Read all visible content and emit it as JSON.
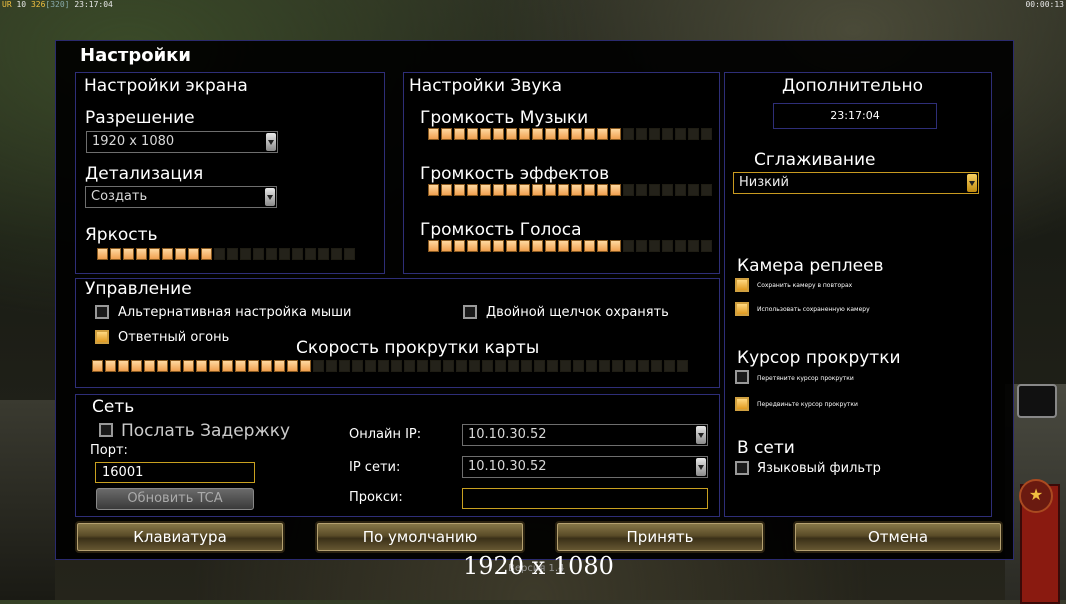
{
  "hud": {
    "left_prefix": "UR",
    "left_a": "10",
    "left_b": "326",
    "left_c": "[320]",
    "left_time": "23:17:04",
    "right_time": "00:00:13"
  },
  "title": "Настройки",
  "screen": {
    "header": "Настройки экрана",
    "resolution_label": "Разрешение",
    "resolution_value": "1920 x 1080",
    "detail_label": "Детализация",
    "detail_value": "Создать",
    "brightness_label": "Яркость",
    "brightness_level": 0.45
  },
  "sound": {
    "header": "Настройки Звука",
    "music_label": "Громкость Музыки",
    "music_level": 0.68,
    "effects_label": "Громкость эффектов",
    "effects_level": 0.68,
    "voice_label": "Громкость Голоса",
    "voice_level": 0.68
  },
  "extra": {
    "header": "Дополнительно",
    "clock": "23:17:04",
    "antialias_label": "Сглаживание",
    "antialias_value": "Низкий",
    "replay_header": "Камера реплеев",
    "replay_opt1": "Сохранить камеру в повторах",
    "replay_opt2": "Использовать сохраненную камеру",
    "scroll_header": "Курсор прокрутки",
    "scroll_opt1": "Перетяните курсор прокрутки",
    "scroll_opt2": "Передвиньте курсор прокрутки",
    "online_header": "В сети",
    "lang_filter": "Языковый фильтр"
  },
  "control": {
    "header": "Управление",
    "alt_mouse": "Альтернативная настройка мыши",
    "double_click": "Двойной щелчок охранять",
    "retaliation": "Ответный огонь",
    "scroll_speed_label": "Скорость прокрутки карты",
    "scroll_speed_level": 0.36
  },
  "network": {
    "header": "Сеть",
    "send_delay": "Послать Задержку",
    "port_label": "Порт:",
    "port_value": "16001",
    "update_btn": "Обновить TCA",
    "online_ip_label": "Онлайн IP:",
    "online_ip_value": "10.10.30.52",
    "lan_ip_label": "IP сети:",
    "lan_ip_value": "10.10.30.52",
    "proxy_label": "Прокси:",
    "proxy_value": ""
  },
  "buttons": {
    "keyboard": "Клавиатура",
    "defaults": "По умолчанию",
    "accept": "Принять",
    "cancel": "Отмена"
  },
  "bottom_resolution": "1920 x 1080",
  "version": "Версия 1.4"
}
